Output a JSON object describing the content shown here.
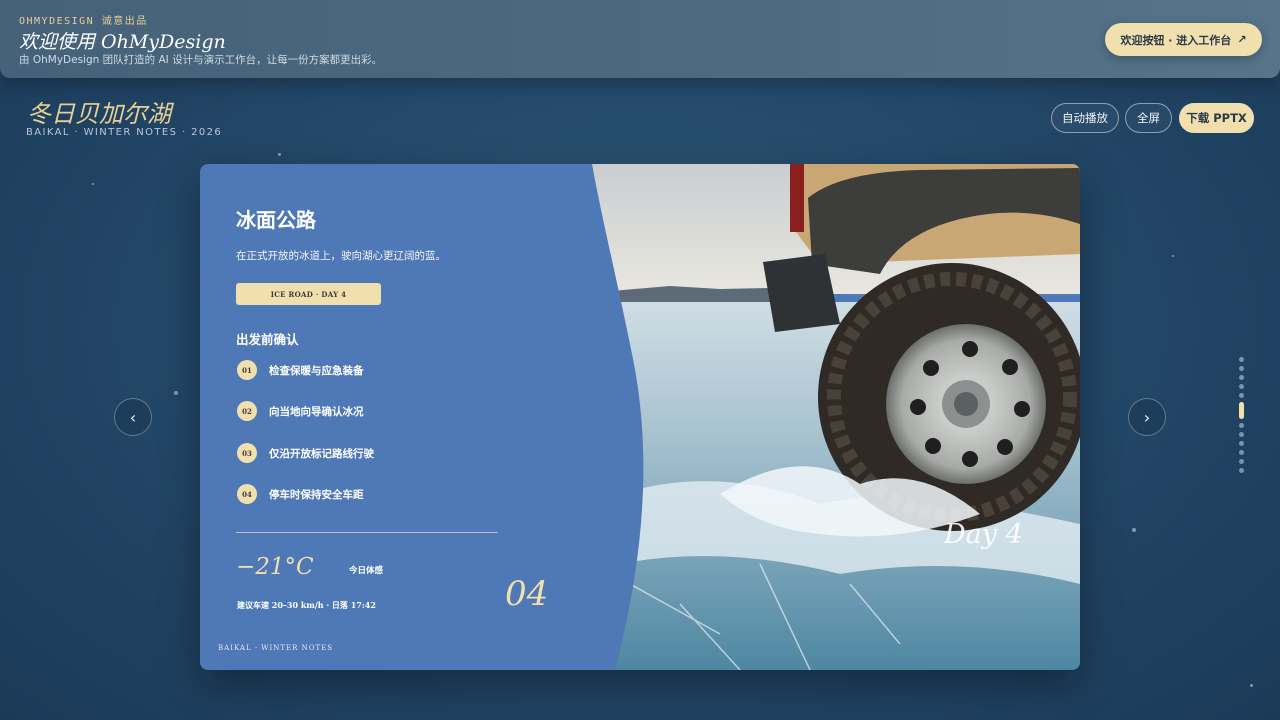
{
  "banner": {
    "eyebrow": "OHMYDESIGN  诚意出品",
    "title": "欢迎使用 OhMyDesign",
    "subtitle": "由 OhMyDesign 团队打造的 AI 设计与演示工作台，让每一份方案都更出彩。",
    "cta_label": "欢迎按钮 · 进入工作台",
    "cta_icon": "↗"
  },
  "deck": {
    "title": "冬日贝加尔湖",
    "subtitle": "BAIKAL · WINTER NOTES · 2026"
  },
  "toolbar": {
    "autoplay_label": "自动播放",
    "fullscreen_label": "全屏",
    "download_label": "下载 PPTX"
  },
  "nav": {
    "prev_icon": "‹",
    "next_icon": "›"
  },
  "progress": {
    "total": 12,
    "current": 5
  },
  "slide": {
    "title": "冰面公路",
    "lead": "在正式开放的冰道上，驶向湖心更辽阔的蓝。",
    "tag": "ICE ROAD · DAY 4",
    "section_title": "出发前确认",
    "steps": [
      {
        "num": "01",
        "label": "检查保暖与应急装备"
      },
      {
        "num": "02",
        "label": "向当地向导确认冰况"
      },
      {
        "num": "03",
        "label": "仅沿开放标记路线行驶"
      },
      {
        "num": "04",
        "label": "停车时保持安全车距"
      }
    ],
    "temperature": "−21°C",
    "temperature_label": "今日体感",
    "info": "建议车速 20–30 km/h · 日落 17:42",
    "page_number": "04",
    "footer": "BAIKAL · WINTER NOTES",
    "photo_caption": "Day 4"
  },
  "colors": {
    "accent": "#f1dfae",
    "slide_panel": "#4f78b6",
    "background": "#24496a"
  }
}
